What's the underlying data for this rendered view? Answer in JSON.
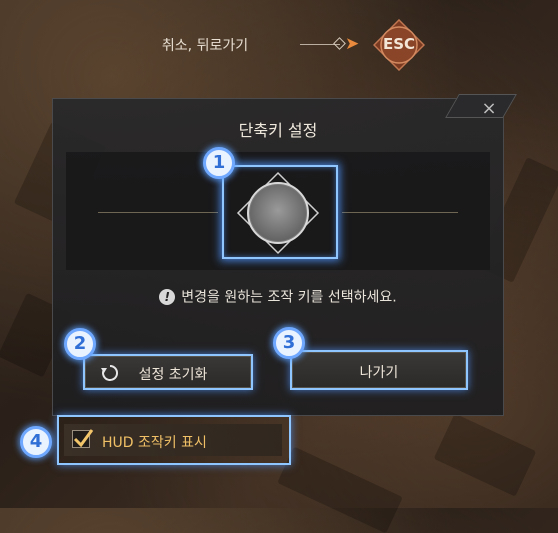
{
  "top_hint": {
    "label": "취소, 뒤로가기",
    "key": "ESC",
    "arrow_color": "#e98a3c"
  },
  "dialog": {
    "title": "단축키 설정",
    "close_icon": "×",
    "message_icon": "!",
    "message": "변경을 원하는 조작 키를 선택하세요.",
    "reset_button": "설정 초기화",
    "exit_button": "나가기",
    "hud_checkbox": {
      "label": "HUD 조작키 표시",
      "checked": true
    }
  },
  "callouts": [
    "1",
    "2",
    "3",
    "4"
  ],
  "colors": {
    "highlight": "#8fc6ff",
    "hud_label": "#f0c066",
    "badge_border": "#6fa8ff"
  }
}
